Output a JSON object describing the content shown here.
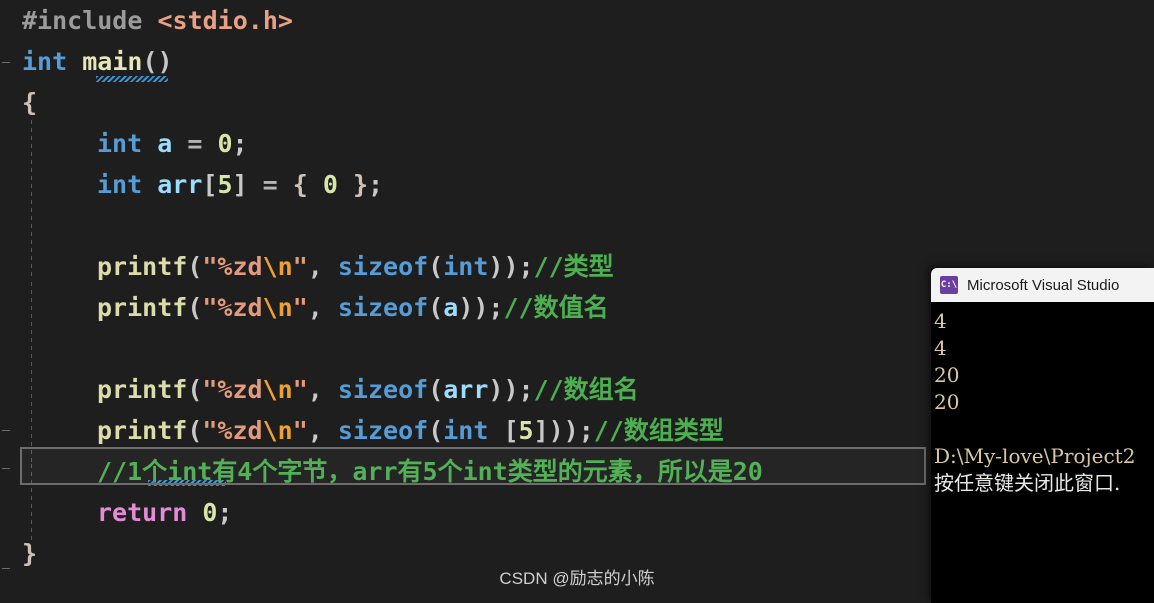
{
  "editor": {
    "language": "c",
    "background": "#1e1e1e",
    "lines": [
      {
        "n": 1,
        "tokens": [
          {
            "t": "#include ",
            "c": "t-pre"
          },
          {
            "t": "<stdio.h>",
            "c": "t-hdr"
          }
        ]
      },
      {
        "n": 2,
        "tokens": [
          {
            "t": "int ",
            "c": "t-kw"
          },
          {
            "t": "main",
            "c": "t-fn2"
          },
          {
            "t": "()",
            "c": "t-punc"
          }
        ]
      },
      {
        "n": 3,
        "tokens": [
          {
            "t": "{",
            "c": "t-brace"
          }
        ]
      },
      {
        "n": 4,
        "indent": 4,
        "tokens": [
          {
            "t": "int ",
            "c": "t-kw"
          },
          {
            "t": "a",
            "c": "t-var"
          },
          {
            "t": " = ",
            "c": "t-op"
          },
          {
            "t": "0",
            "c": "t-num"
          },
          {
            "t": ";",
            "c": "t-punc"
          }
        ]
      },
      {
        "n": 5,
        "indent": 4,
        "tokens": [
          {
            "t": "int ",
            "c": "t-kw"
          },
          {
            "t": "arr",
            "c": "t-var"
          },
          {
            "t": "[",
            "c": "t-punc"
          },
          {
            "t": "5",
            "c": "t-num"
          },
          {
            "t": "]",
            "c": "t-punc"
          },
          {
            "t": " = ",
            "c": "t-op"
          },
          {
            "t": "{ ",
            "c": "t-brace"
          },
          {
            "t": "0",
            "c": "t-num"
          },
          {
            "t": " }",
            "c": "t-brace"
          },
          {
            "t": ";",
            "c": "t-punc"
          }
        ]
      },
      {
        "n": 6,
        "tokens": []
      },
      {
        "n": 7,
        "indent": 4,
        "tokens": [
          {
            "t": "printf",
            "c": "t-fn"
          },
          {
            "t": "(",
            "c": "t-punc"
          },
          {
            "t": "\"%zd",
            "c": "t-str"
          },
          {
            "t": "\\n",
            "c": "t-esc"
          },
          {
            "t": "\"",
            "c": "t-str"
          },
          {
            "t": ", ",
            "c": "t-punc"
          },
          {
            "t": "sizeof",
            "c": "t-kw2"
          },
          {
            "t": "(",
            "c": "t-punc"
          },
          {
            "t": "int",
            "c": "t-kw"
          },
          {
            "t": "))",
            "c": "t-punc"
          },
          {
            "t": ";",
            "c": "t-punc"
          },
          {
            "t": "//类型",
            "c": "t-cmt"
          }
        ]
      },
      {
        "n": 8,
        "indent": 4,
        "tokens": [
          {
            "t": "printf",
            "c": "t-fn"
          },
          {
            "t": "(",
            "c": "t-punc"
          },
          {
            "t": "\"%zd",
            "c": "t-str"
          },
          {
            "t": "\\n",
            "c": "t-esc"
          },
          {
            "t": "\"",
            "c": "t-str"
          },
          {
            "t": ", ",
            "c": "t-punc"
          },
          {
            "t": "sizeof",
            "c": "t-kw2"
          },
          {
            "t": "(",
            "c": "t-punc"
          },
          {
            "t": "a",
            "c": "t-var"
          },
          {
            "t": "))",
            "c": "t-punc"
          },
          {
            "t": ";",
            "c": "t-punc"
          },
          {
            "t": "//数值名",
            "c": "t-cmt"
          }
        ]
      },
      {
        "n": 9,
        "tokens": []
      },
      {
        "n": 10,
        "indent": 4,
        "tokens": [
          {
            "t": "printf",
            "c": "t-fn"
          },
          {
            "t": "(",
            "c": "t-punc"
          },
          {
            "t": "\"%zd",
            "c": "t-str"
          },
          {
            "t": "\\n",
            "c": "t-esc"
          },
          {
            "t": "\"",
            "c": "t-str"
          },
          {
            "t": ", ",
            "c": "t-punc"
          },
          {
            "t": "sizeof",
            "c": "t-kw2"
          },
          {
            "t": "(",
            "c": "t-punc"
          },
          {
            "t": "arr",
            "c": "t-var"
          },
          {
            "t": "))",
            "c": "t-punc"
          },
          {
            "t": ";",
            "c": "t-punc"
          },
          {
            "t": "//数组名",
            "c": "t-cmt"
          }
        ]
      },
      {
        "n": 11,
        "indent": 4,
        "tokens": [
          {
            "t": "printf",
            "c": "t-fn"
          },
          {
            "t": "(",
            "c": "t-punc"
          },
          {
            "t": "\"%zd",
            "c": "t-str"
          },
          {
            "t": "\\n",
            "c": "t-esc"
          },
          {
            "t": "\"",
            "c": "t-str"
          },
          {
            "t": ", ",
            "c": "t-punc"
          },
          {
            "t": "sizeof",
            "c": "t-kw2"
          },
          {
            "t": "(",
            "c": "t-punc"
          },
          {
            "t": "int",
            "c": "t-kw"
          },
          {
            "t": " [",
            "c": "t-punc"
          },
          {
            "t": "5",
            "c": "t-num"
          },
          {
            "t": "]))",
            "c": "t-punc"
          },
          {
            "t": ";",
            "c": "t-punc"
          },
          {
            "t": "//数组类型",
            "c": "t-cmt"
          }
        ]
      },
      {
        "n": 12,
        "indent": 4,
        "selected": true,
        "tokens": [
          {
            "t": "//1个int有4个字节，arr有5个int类型的元素，所以是20",
            "c": "t-cmt"
          }
        ]
      },
      {
        "n": 13,
        "indent": 4,
        "tokens": [
          {
            "t": "return ",
            "c": "t-ret"
          },
          {
            "t": "0",
            "c": "t-num"
          },
          {
            "t": ";",
            "c": "t-punc"
          }
        ]
      },
      {
        "n": 14,
        "tokens": [
          {
            "t": "}",
            "c": "t-brace"
          }
        ]
      }
    ]
  },
  "console": {
    "title": "Microsoft Visual Studio",
    "icon": "console-window-icon",
    "icon_label": "C:\\",
    "output": [
      {
        "text": "4"
      },
      {
        "text": "4"
      },
      {
        "text": "20"
      },
      {
        "text": "20"
      },
      {
        "text": "",
        "blank": true
      },
      {
        "text": "D:\\My-love\\Project2"
      },
      {
        "text": "按任意键关闭此窗口.",
        "cjk": true
      }
    ]
  },
  "watermark": {
    "text": "CSDN @励志的小陈"
  },
  "colors": {
    "editor_background": "#1e1e1e",
    "comment_green": "#4caf50",
    "keyword_blue": "#569cd6",
    "string_orange": "#e39a7d",
    "escape_orange": "#f0a030",
    "function_yellow": "#dcdcaa",
    "return_pink": "#e48bd8",
    "number_olive": "#d7e6a8",
    "selection_border": "#6d6d6d",
    "console_background": "#000000",
    "console_titlebar": "#f3f3f3",
    "console_text": "#d9c9a3"
  }
}
